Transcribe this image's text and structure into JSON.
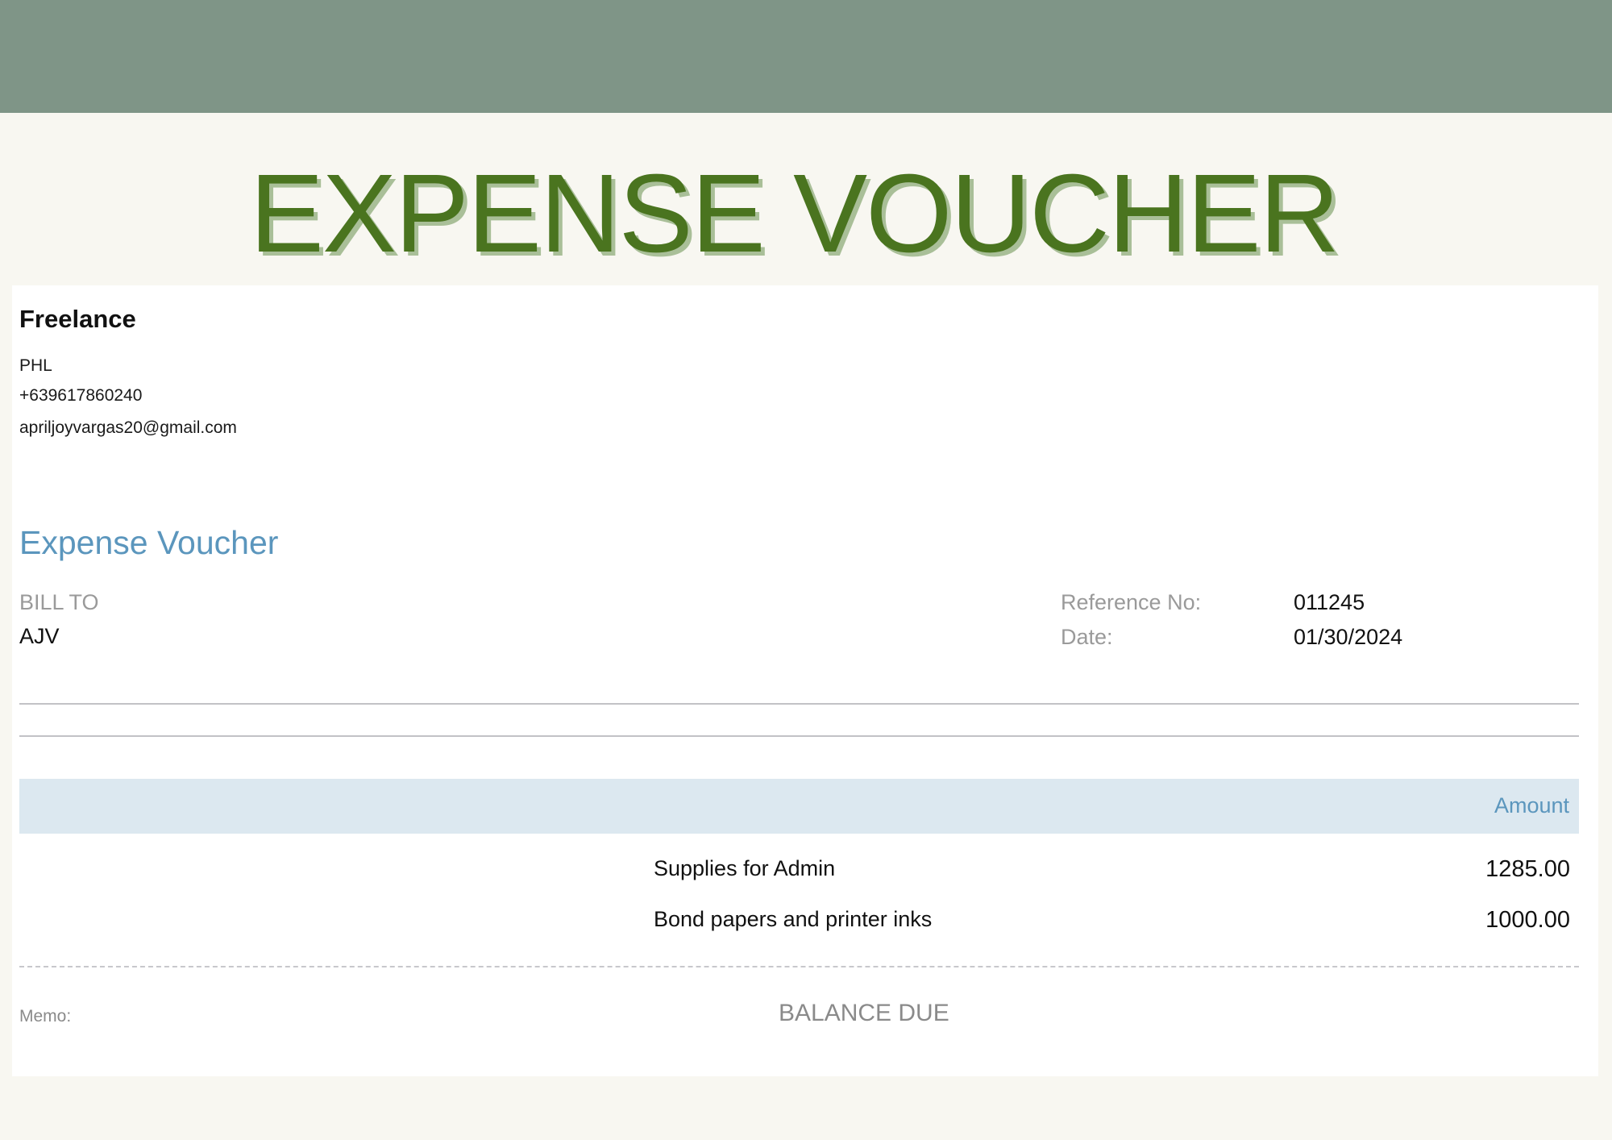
{
  "colors": {
    "top_band": "#7f9587",
    "title_text": "#4a741f",
    "title_shadow": "#a9bf98",
    "accent_blue": "#5b96bd",
    "table_header_bg": "#dce8f0"
  },
  "poster": {
    "title": "EXPENSE VOUCHER"
  },
  "company": {
    "name": "Freelance",
    "country": "PHL",
    "phone": "+639617860240",
    "email": "apriljoyvargas20@gmail.com"
  },
  "voucher": {
    "heading": "Expense Voucher",
    "bill_to_label": "BILL TO",
    "bill_to_value": "AJV",
    "reference_label": "Reference No:",
    "reference_value": "011245",
    "date_label": "Date:",
    "date_value": "01/30/2024"
  },
  "table": {
    "amount_header": "Amount",
    "items": [
      {
        "description": "Supplies for Admin",
        "amount": "1285.00"
      },
      {
        "description": "Bond papers and printer inks",
        "amount": "1000.00"
      }
    ]
  },
  "footer": {
    "memo_label": "Memo:",
    "balance_label": "BALANCE DUE"
  }
}
